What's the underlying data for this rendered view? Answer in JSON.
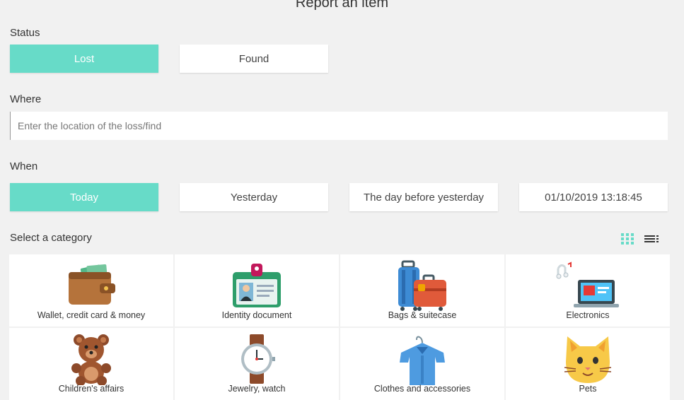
{
  "title": "Report an item",
  "status": {
    "label": "Status",
    "options": [
      "Lost",
      "Found"
    ],
    "selected": "Lost"
  },
  "where": {
    "label": "Where",
    "placeholder": "Enter the location of the loss/find",
    "value": ""
  },
  "when": {
    "label": "When",
    "options": [
      "Today",
      "Yesterday",
      "The day before yesterday",
      "01/10/2019 13:18:45"
    ],
    "selected": "Today"
  },
  "category": {
    "label": "Select a category",
    "view_modes": [
      "grid-view-icon",
      "list-view-icon"
    ],
    "active_view": "grid",
    "items": [
      {
        "label": "Wallet, credit card & money",
        "icon": "wallet-icon"
      },
      {
        "label": "Identity document",
        "icon": "id-card-icon"
      },
      {
        "label": "Bags & suitecase",
        "icon": "suitcase-icon"
      },
      {
        "label": "Electronics",
        "icon": "laptop-icon"
      },
      {
        "label": "Children's affairs",
        "icon": "teddy-bear-icon"
      },
      {
        "label": "Jewelry, watch",
        "icon": "watch-icon"
      },
      {
        "label": "Clothes and accessories",
        "icon": "shirt-icon"
      },
      {
        "label": "Pets",
        "icon": "cat-icon"
      }
    ]
  },
  "colors": {
    "accent": "#67dbc8",
    "background": "#f1f1f1"
  }
}
